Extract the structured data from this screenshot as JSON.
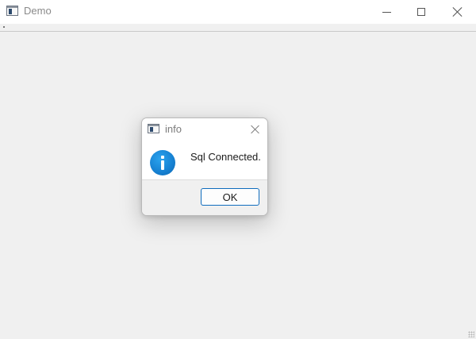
{
  "window": {
    "title": "Demo",
    "icon": "app-window-icon",
    "controls": {
      "minimize_icon": "minimize-icon",
      "maximize_icon": "maximize-icon",
      "close_icon": "close-icon"
    }
  },
  "dialog": {
    "title": "info",
    "icon": "app-window-icon",
    "close_icon": "close-icon",
    "message_icon": "info-icon",
    "message": "Sql Connected.",
    "ok_label": "OK"
  },
  "colors": {
    "accent": "#0f6cbd",
    "info_icon": "#1680d1",
    "titlebar": "#ffffff",
    "client_background": "#f0f0f0"
  }
}
